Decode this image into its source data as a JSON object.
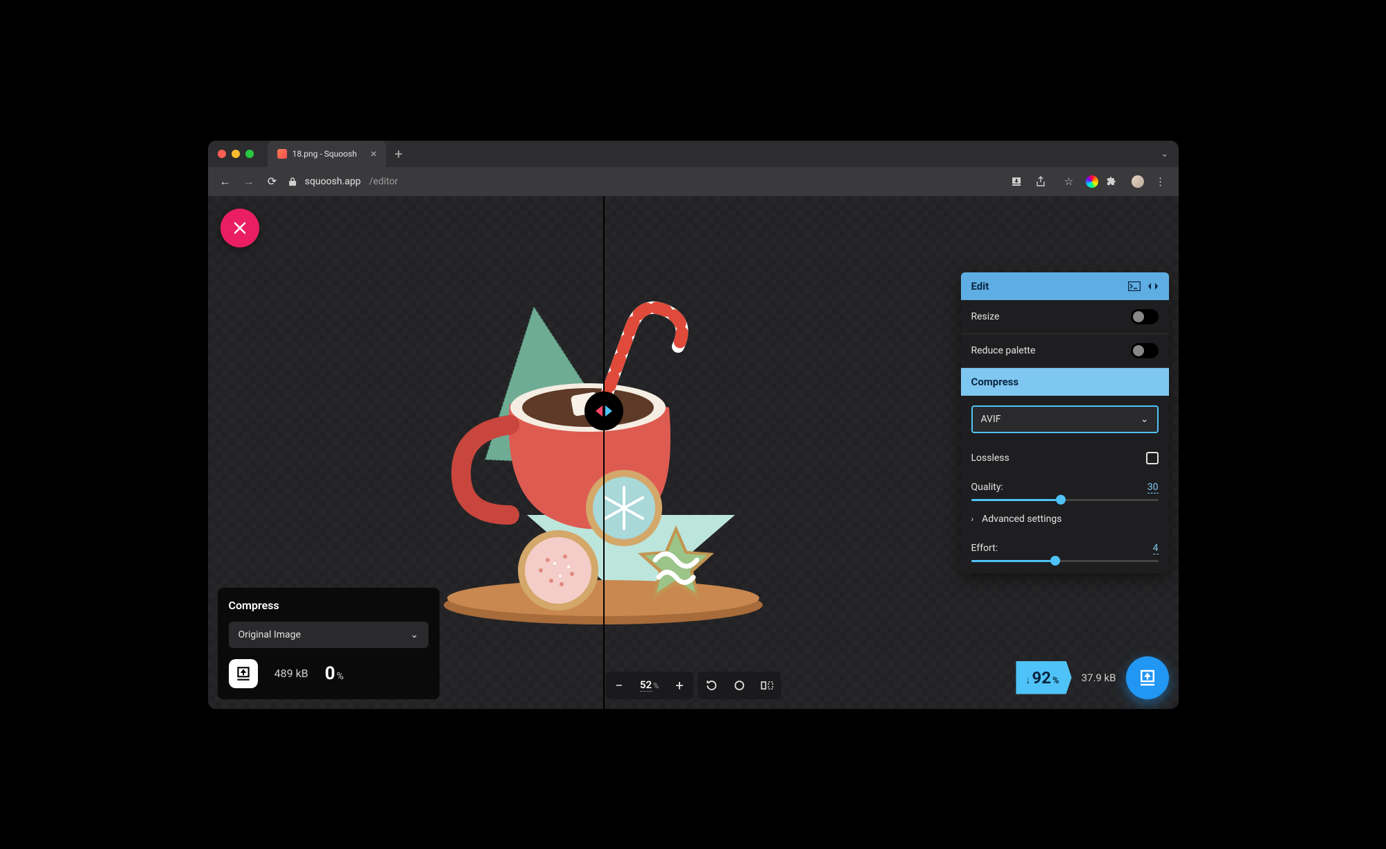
{
  "browser": {
    "tab_title": "18.png - Squoosh",
    "url_host": "squoosh.app",
    "url_path": "/editor"
  },
  "zoom": {
    "value": "52",
    "unit": "%"
  },
  "left": {
    "title": "Compress",
    "format": "Original Image",
    "file_size": "489 kB",
    "savings_value": "0",
    "savings_unit": "%"
  },
  "right": {
    "edit_title": "Edit",
    "resize_label": "Resize",
    "reduce_label": "Reduce palette",
    "compress_title": "Compress",
    "format": "AVIF",
    "lossless_label": "Lossless",
    "quality_label": "Quality:",
    "quality_value": "30",
    "advanced_label": "Advanced settings",
    "effort_label": "Effort:",
    "effort_value": "4",
    "savings_value": "92",
    "savings_unit": "%",
    "file_size": "37.9 kB"
  }
}
